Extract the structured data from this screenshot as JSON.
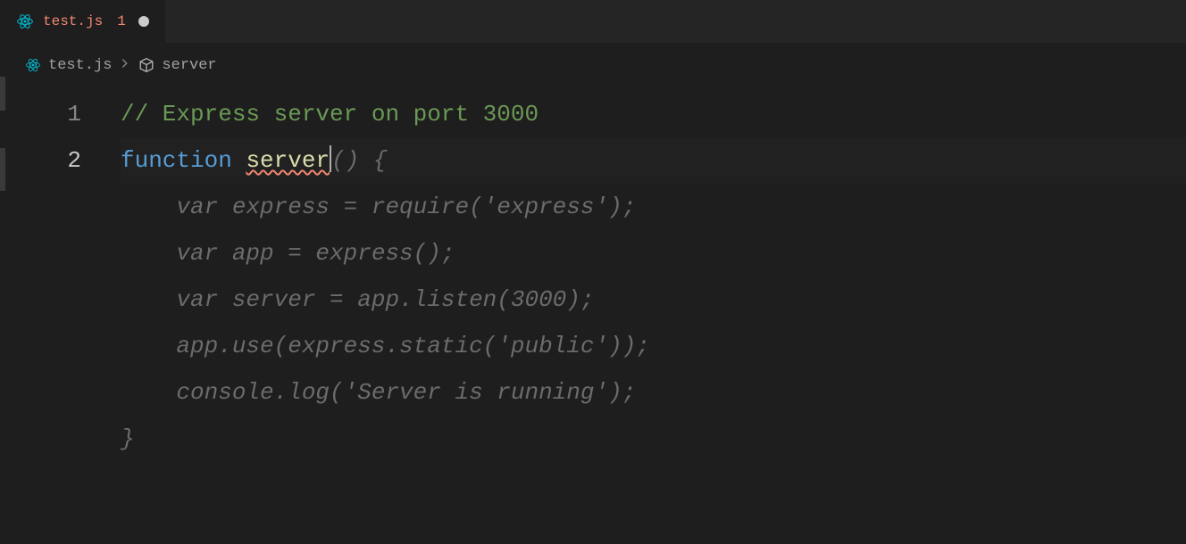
{
  "tab": {
    "name": "test.js",
    "errorCount": "1"
  },
  "breadcrumb": {
    "file": "test.js",
    "symbol": "server"
  },
  "code": {
    "line1_number": "1",
    "line1_comment": "// Express server on port 3000",
    "line2_number": "2",
    "line2_keyword": "function",
    "line2_funcname": "server",
    "line2_ghost_paren": "() {",
    "ghost_line3": "    var express = require('express');",
    "ghost_line4": "    var app = express();",
    "ghost_line5": "    var server = app.listen(3000);",
    "ghost_line6": "    app.use(express.static('public'));",
    "ghost_line7": "    console.log('Server is running');",
    "ghost_line8": "}"
  }
}
